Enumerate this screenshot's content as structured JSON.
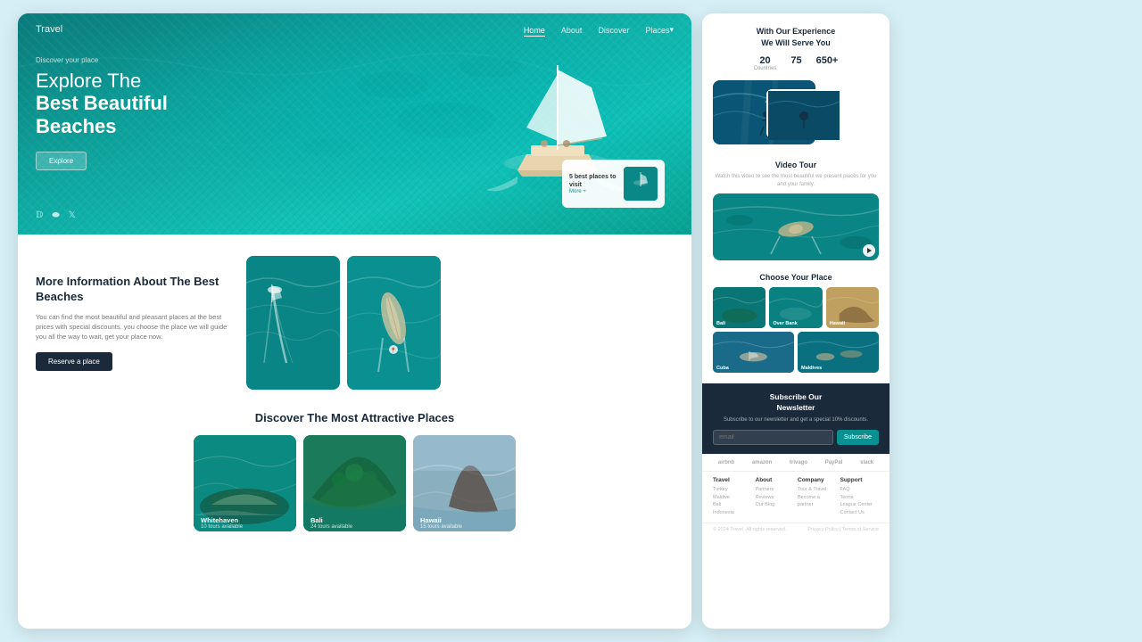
{
  "page": {
    "background": "#d6eef5"
  },
  "nav": {
    "logo": "Travel",
    "links": [
      "Home",
      "About",
      "Discover",
      "Places"
    ],
    "active": "Home"
  },
  "hero": {
    "discover_label": "Discover your place",
    "title_line1": "Explore The",
    "title_line2": "Best Beautiful",
    "title_line3": "Beaches",
    "explore_btn": "Explore",
    "social_icons": [
      "facebook",
      "instagram",
      "twitter"
    ],
    "mini_card_text": "5 best places to visit",
    "mini_card_more": "More +"
  },
  "section_info": {
    "title": "More Information About The Best Beaches",
    "description": "You can find the most beautiful and pleasant places at the best prices with special discounts. you choose the place we will guide you all the way to wait, get your place now.",
    "reserve_btn": "Reserve a place"
  },
  "section_discover": {
    "title": "Discover The Most Attractive Places",
    "cards": [
      {
        "name": "Whitehaven",
        "sub": "10 tours available"
      },
      {
        "name": "Bali",
        "sub": "24 tours available"
      },
      {
        "name": "Hawaii",
        "sub": "15 tours available"
      }
    ]
  },
  "right_panel": {
    "stats_title_line1": "With Our Experience",
    "stats_title_line2": "We Will Serve You",
    "stats": [
      {
        "number": "20",
        "label": "Countries"
      },
      {
        "number": "75",
        "label": ""
      },
      {
        "number": "650+",
        "label": ""
      }
    ],
    "video_tour": {
      "title": "Video Tour",
      "description": "Watch this video to see the most beautiful we present places for you and your family."
    },
    "choose_title": "Choose Your Place",
    "choose_cards": [
      {
        "name": "Bali",
        "class": "cc-bali"
      },
      {
        "name": "Over Bank",
        "class": "cc-overbank"
      },
      {
        "name": "Hawaii",
        "class": "cc-hawaii"
      },
      {
        "name": "Cuba",
        "class": "cc-cuba"
      },
      {
        "name": "Maldives",
        "class": "cc-maldives"
      }
    ],
    "newsletter": {
      "title_line1": "Subscribe Our",
      "title_line2": "Newsletter",
      "description": "Subscribe to our newsletter and get a special 10% discounts.",
      "input_placeholder": "email",
      "btn_label": "Subscribe"
    },
    "brands": [
      "airbnb",
      "amazon",
      "trivago",
      "PayPal",
      "slack"
    ],
    "footer_cols": [
      {
        "title": "Travel",
        "items": [
          "Turkey",
          "Maldive",
          "Bali",
          "Indonesia"
        ]
      },
      {
        "title": "About",
        "items": [
          "Partners",
          "Reviews",
          "Our Blog"
        ]
      },
      {
        "title": "Company",
        "items": [
          "Tour & Travel",
          "Become a partner"
        ]
      },
      {
        "title": "Support",
        "items": [
          "FAQ",
          "Terms",
          "League Center",
          "Contact Us"
        ]
      }
    ],
    "footer_copy": "© 2024 Travel. All rights reserved.",
    "footer_privacy": "Privacy Policy | Terms of Service"
  }
}
